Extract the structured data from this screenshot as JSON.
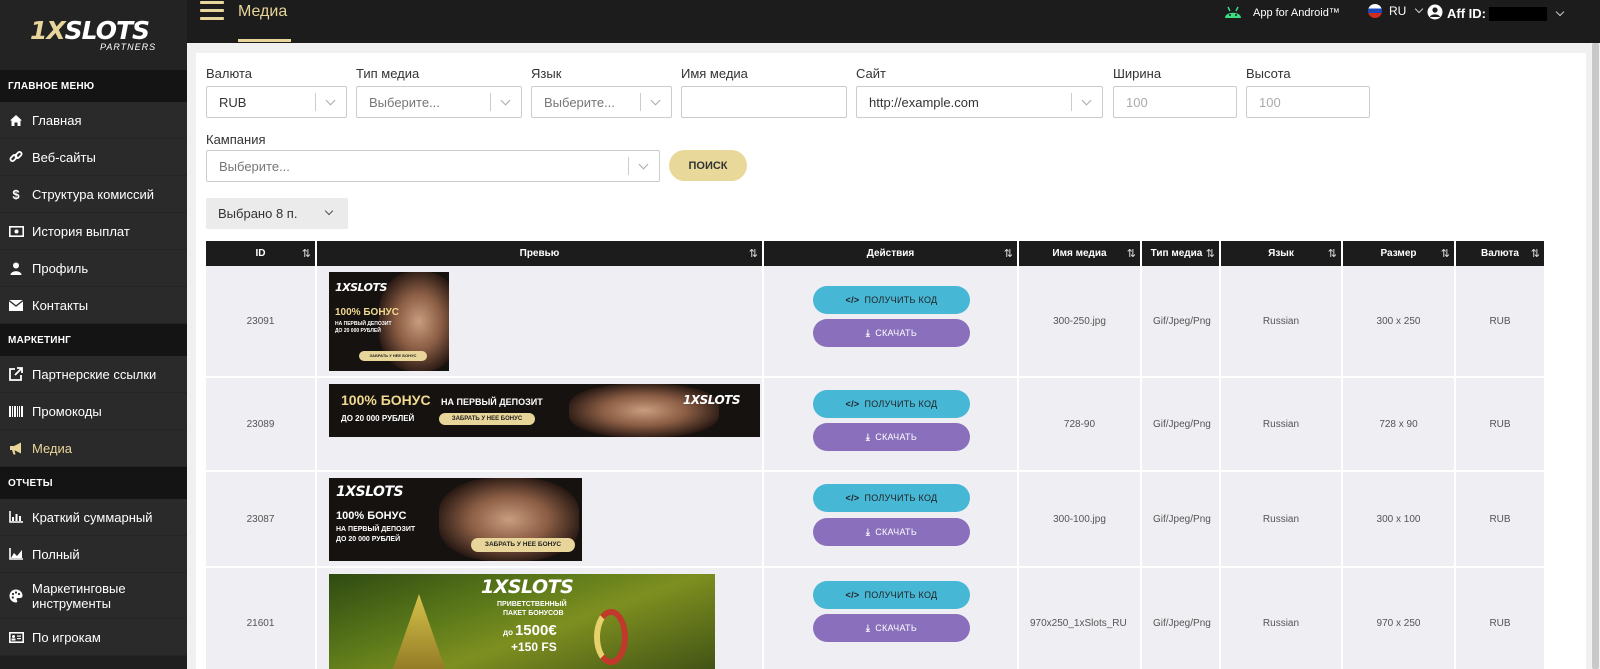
{
  "sidebar": {
    "logo_prefix": "1X",
    "logo_main": "SLOTS",
    "logo_sub": "PARTNERS",
    "sections": [
      {
        "title": "ГЛАВНОЕ МЕНЮ",
        "items": [
          {
            "label": "Главная",
            "icon": "home-icon"
          },
          {
            "label": "Веб-сайты",
            "icon": "link-icon"
          },
          {
            "label": "Структура комиссий",
            "icon": "dollar-icon"
          },
          {
            "label": "История выплат",
            "icon": "money-icon"
          },
          {
            "label": "Профиль",
            "icon": "user-icon"
          },
          {
            "label": "Контакты",
            "icon": "envelope-icon"
          }
        ]
      },
      {
        "title": "МАРКЕТИНГ",
        "items": [
          {
            "label": "Партнерские ссылки",
            "icon": "external-link-icon"
          },
          {
            "label": "Промокоды",
            "icon": "barcode-icon"
          },
          {
            "label": "Медиа",
            "icon": "megaphone-icon",
            "active": true
          }
        ]
      },
      {
        "title": "ОТЧЕТЫ",
        "items": [
          {
            "label": "Краткий суммарный",
            "icon": "bar-chart-icon"
          },
          {
            "label": "Полный",
            "icon": "area-chart-icon"
          },
          {
            "label": "Маркетинговые инструменты",
            "icon": "palette-icon"
          },
          {
            "label": "По игрокам",
            "icon": "id-card-icon"
          }
        ]
      }
    ]
  },
  "topbar": {
    "title": "Медиа",
    "android_label": "App for Android™",
    "language": "RU",
    "aff_label": "Aff ID:"
  },
  "filters": {
    "currency_label": "Валюта",
    "currency_value": "RUB",
    "media_type_label": "Тип медиа",
    "media_type_placeholder": "Выберите...",
    "language_label": "Язык",
    "language_placeholder": "Выберите...",
    "media_name_label": "Имя медиа",
    "site_label": "Сайт",
    "site_value": "http://example.com",
    "width_label": "Ширина",
    "width_placeholder": "100",
    "height_label": "Высота",
    "height_placeholder": "100",
    "campaign_label": "Кампания",
    "campaign_placeholder": "Выберите...",
    "search_label": "ПОИСК",
    "selected_label": "Выбрано 8 п."
  },
  "table": {
    "columns": [
      "ID",
      "Превью",
      "Действия",
      "Имя медиа",
      "Тип медиа",
      "Язык",
      "Размер",
      "Валюта"
    ],
    "get_code_label": "ПОЛУЧИТЬ КОД",
    "download_label": "СКАЧАТЬ",
    "banner_logo": "1XSLOTS",
    "rows": [
      {
        "id": "23091",
        "name": "300-250.jpg",
        "type": "Gif/Jpeg/Png",
        "lang": "Russian",
        "size": "300 x 250",
        "currency": "RUB",
        "banner": {
          "bonus": "100% БОНУС",
          "line1": "НА ПЕРВЫЙ ДЕПОЗИТ",
          "line2": "ДО 20 000 РУБЛЕЙ",
          "btn": "ЗАБРАТЬ У НЕЕ БОНУС"
        }
      },
      {
        "id": "23089",
        "name": "728-90",
        "type": "Gif/Jpeg/Png",
        "lang": "Russian",
        "size": "728 x 90",
        "currency": "RUB",
        "banner": {
          "bonus": "100% БОНУС",
          "line1": "НА ПЕРВЫЙ ДЕПОЗИТ",
          "line2": "ДО 20 000 РУБЛЕЙ",
          "btn": "ЗАБРАТЬ У НЕЕ БОНУС"
        }
      },
      {
        "id": "23087",
        "name": "300-100.jpg",
        "type": "Gif/Jpeg/Png",
        "lang": "Russian",
        "size": "300 x 100",
        "currency": "RUB",
        "banner": {
          "bonus": "100% БОНУС",
          "line1": "НА ПЕРВЫЙ ДЕПОЗИТ",
          "line2": "ДО 20 000 РУБЛЕЙ",
          "btn": "ЗАБРАТЬ У НЕЕ БОНУС"
        }
      },
      {
        "id": "21601",
        "name": "970x250_1xSlots_RU",
        "type": "Gif/Jpeg/Png",
        "lang": "Russian",
        "size": "970 x 250",
        "currency": "RUB",
        "banner": {
          "line1": "ПРИВЕТСТВЕННЫЙ",
          "line2": "ПАКЕТ БОНУСОВ",
          "amount_prefix": "до",
          "amount": "1500€",
          "fs": "+150 FS"
        }
      }
    ]
  },
  "colors": {
    "accent": "#e8d59a",
    "sidebar_bg": "#1f1f1f",
    "code_button": "#47b7d6",
    "download_button": "#8a6fbd"
  }
}
